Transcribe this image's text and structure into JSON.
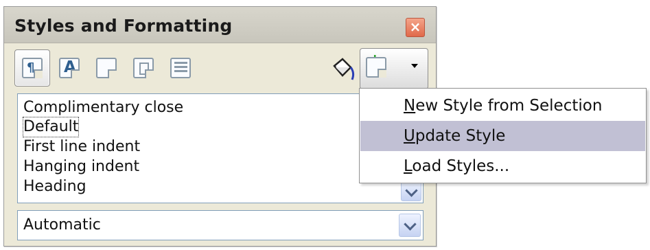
{
  "panel": {
    "title": "Styles and Formatting",
    "close_glyph": "×"
  },
  "toolbar": {
    "buttons": [
      {
        "name": "paragraph-styles-icon",
        "state": "pressed"
      },
      {
        "name": "character-styles-icon",
        "state": "normal"
      },
      {
        "name": "frame-styles-icon",
        "state": "normal"
      },
      {
        "name": "page-styles-icon",
        "state": "normal"
      },
      {
        "name": "list-styles-icon",
        "state": "normal"
      }
    ],
    "fill_format_icon": "paint-bucket-icon",
    "new_style_icon": "new-style-from-selection-icon"
  },
  "style_list": {
    "items": [
      {
        "label": "Complimentary close"
      },
      {
        "label": "Default",
        "selected": true
      },
      {
        "label": "First line indent"
      },
      {
        "label": "Hanging indent"
      },
      {
        "label": "Heading"
      }
    ]
  },
  "filter": {
    "value": "Automatic"
  },
  "menu": {
    "items": [
      {
        "mnemonic": "N",
        "rest": "ew Style from Selection"
      },
      {
        "mnemonic": "U",
        "rest": "pdate Style",
        "highlighted": true
      },
      {
        "mnemonic": "L",
        "rest": "oad Styles..."
      }
    ]
  },
  "colors": {
    "panel_bg": "#ece9d8",
    "highlight": "#c1c0d4",
    "close_button": "#e0694a",
    "icon_blue": "#2f5f8f"
  }
}
